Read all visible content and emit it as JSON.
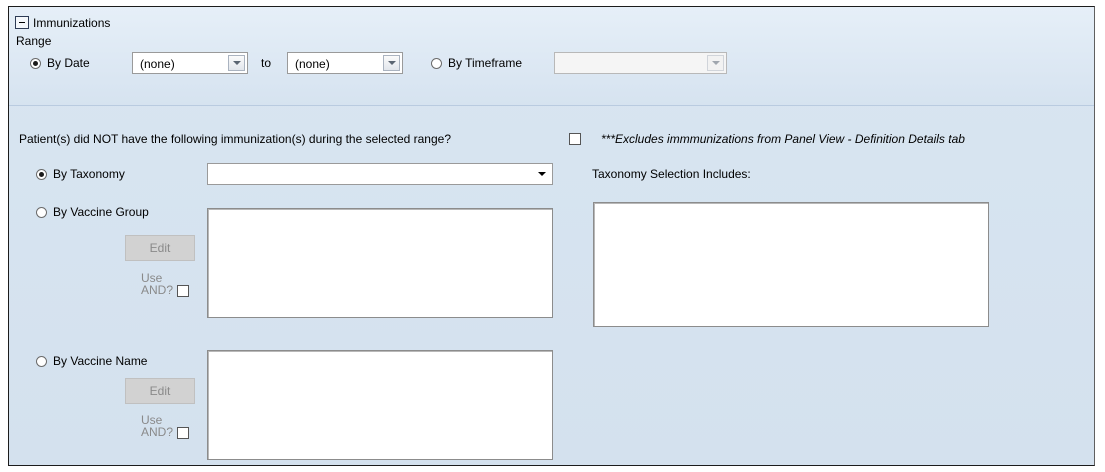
{
  "section": {
    "title": "Immunizations",
    "range_label": "Range",
    "by_date_label": "By Date",
    "from_value": "(none)",
    "to_label": "to",
    "to_value": "(none)",
    "by_timeframe_label": "By Timeframe",
    "timeframe_value": ""
  },
  "criteria": {
    "not_question": "Patient(s) did NOT have the following immunization(s) during the selected range?",
    "exclude_note": "***Excludes immmunizations from Panel View - Definition Details tab",
    "by_taxonomy_label": "By Taxonomy",
    "taxonomy_value": "",
    "taxonomy_includes_label": "Taxonomy Selection Includes:",
    "by_vaccine_group_label": "By Vaccine Group",
    "by_vaccine_name_label": "By Vaccine Name",
    "edit_label": "Edit",
    "use_label": "Use",
    "and_label": "AND?"
  },
  "colors": {
    "panel_bg": "#d4e1ee",
    "border": "#1c1c1c"
  }
}
